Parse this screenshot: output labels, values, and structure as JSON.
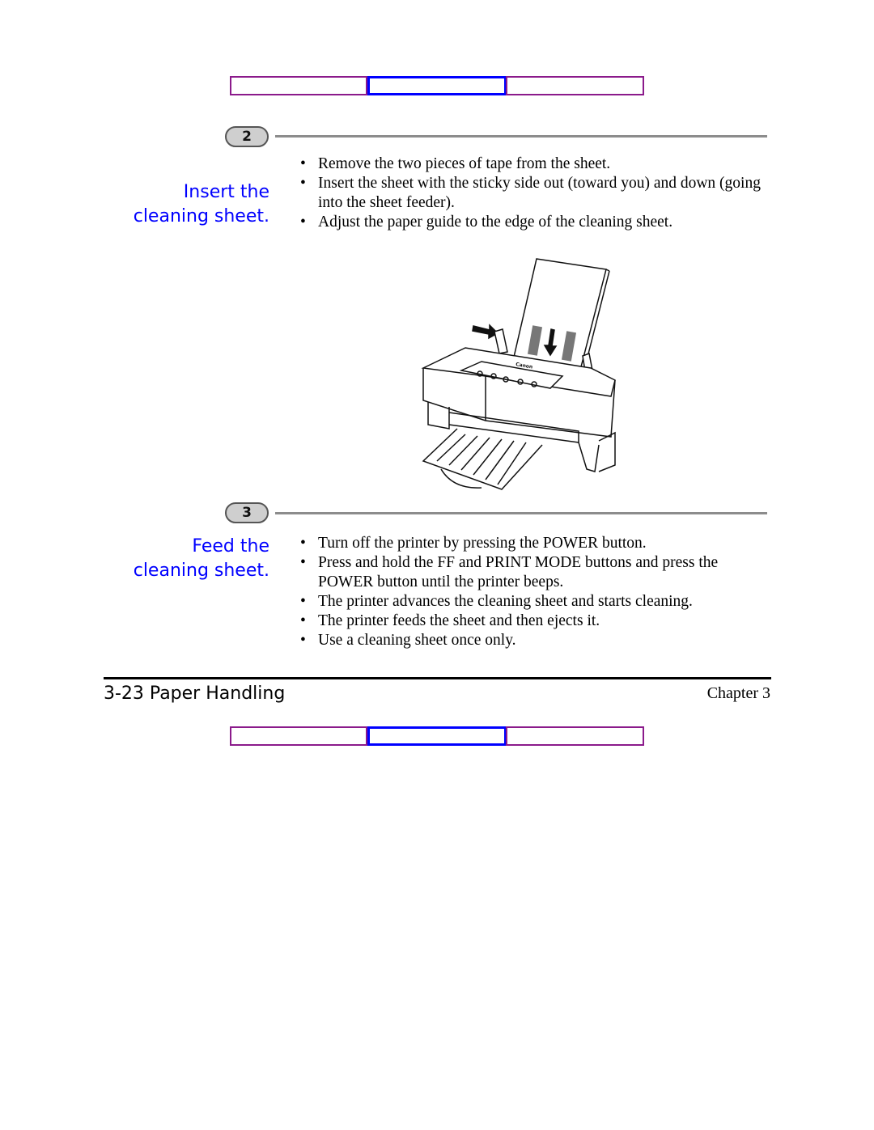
{
  "nav_top": [
    "",
    "",
    ""
  ],
  "step2": {
    "number": "2",
    "heading_line1": "Insert the",
    "heading_line2": "cleaning sheet.",
    "bullets": [
      "Remove the two pieces of tape from the sheet.",
      "Insert the sheet with the sticky side out (toward you) and down (going into the sheet feeder).",
      "Adjust the paper guide to the edge of the cleaning sheet."
    ]
  },
  "figure": {
    "brand": "Canon"
  },
  "step3": {
    "number": "3",
    "heading_line1": "Feed the",
    "heading_line2": "cleaning sheet.",
    "bullets": [
      "Turn off the printer by pressing the POWER button.",
      "Press and hold the FF and PRINT MODE buttons and press the POWER button until the printer beeps.",
      "The printer advances the cleaning sheet and starts cleaning.",
      "The printer feeds the sheet and then ejects it.",
      "Use a cleaning sheet once only."
    ]
  },
  "footer": {
    "left": "3-23 Paper Handling",
    "right": "Chapter 3"
  },
  "colors": {
    "nav_outer": "#8b1a8b",
    "nav_center": "#0000ff",
    "heading": "#0000ff"
  }
}
